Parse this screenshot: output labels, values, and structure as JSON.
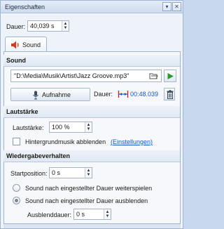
{
  "window": {
    "title": "Eigenschaften"
  },
  "duration": {
    "label": "Dauer:",
    "value": "40,039 s"
  },
  "tabs": [
    {
      "label": "Sound",
      "active": true
    }
  ],
  "sound_section": {
    "heading": "Sound",
    "file_path": "\"D:\\Media\\Musik\\Artist\\Jazz Groove.mp3\"",
    "record_label": "Aufnahme",
    "duration_label": "Dauer:",
    "duration_value": "00:48.039"
  },
  "volume_section": {
    "heading": "Lautstärke",
    "volume_label": "Lautstärke:",
    "volume_value": "100 %",
    "fade_bg_label": "Hintergrundmusik abblenden",
    "fade_bg_checked": false,
    "settings_link": "(Einstellungen)"
  },
  "playback_section": {
    "heading": "Wiedergabeverhalten",
    "start_label": "Startposition:",
    "start_value": "0 s",
    "option_continue": "Sound nach eingestellter Dauer weiterspielen",
    "option_fadeout": "Sound nach eingestellter Dauer ausblenden",
    "selected_option": "option_fadeout",
    "fadeout_duration_label": "Ausblenddauer:",
    "fadeout_duration_value": "0 s"
  },
  "colors": {
    "accent_blue": "#1a55c8",
    "play_green": "#2a9a2a",
    "duration_red": "#c8281e"
  },
  "icons": {
    "tab": "speaker-icon",
    "record": "microphone-icon",
    "browse": "folder-open-icon",
    "play": "play-icon",
    "duration": "duration-span-icon",
    "delete": "trash-icon",
    "close": "close-icon",
    "pin": "dropdown-icon"
  }
}
